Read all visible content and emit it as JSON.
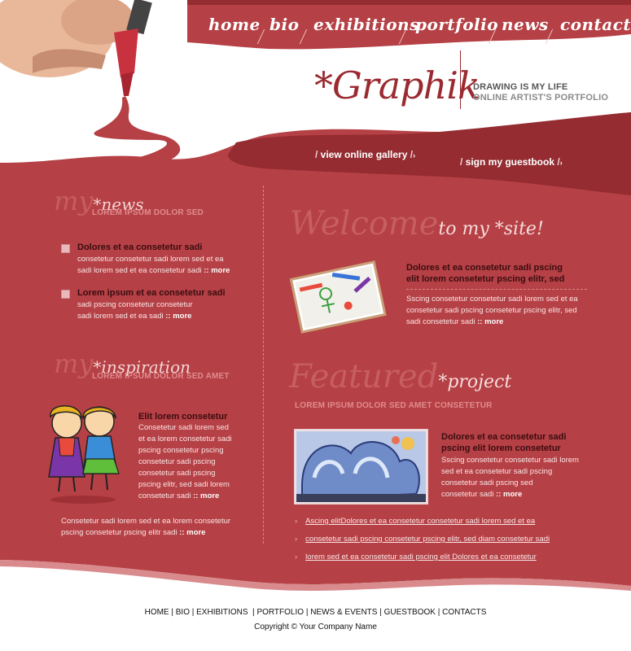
{
  "nav": {
    "home": "home",
    "bio": "bio",
    "exhibitions": "exhibitions",
    "portfolio": "portfolio",
    "news": "news",
    "contact": "contact"
  },
  "brand": {
    "logo": "*Graphik",
    "tagline1": "DRAWING IS MY LIFE",
    "tagline2": "ONLINE ARTIST'S PORTFOLIO"
  },
  "header_links": {
    "gallery": "view online gallery",
    "guestbook": "sign my guestbook"
  },
  "news": {
    "title_big": "my",
    "title_small": "*news",
    "subtitle": "LOREM IPSUM DOLOR SED",
    "items": [
      {
        "title": "Dolores et ea consetetur sadi",
        "line1": "consetetur consetetur sadi lorem sed  et ea",
        "line2": "sadi lorem sed  et ea consetetur sadi",
        "more": ":: more"
      },
      {
        "title": "Lorem ipsum et ea consetetur sadi",
        "line1": "sadi pscing consetetur consetetur",
        "line2": "sadi lorem sed  et ea sadi",
        "more": ":: more"
      }
    ]
  },
  "inspiration": {
    "title_big": "my",
    "title_small": "*inspiration",
    "subtitle": "LOREM IPSUM DOLOR SED AMET",
    "item_title": "Elit lorem consetetur",
    "item_lines": [
      "Consetetur sadi lorem sed",
      "et ea lorem consetetur sadi",
      "pscing consetetur pscing",
      "consetetur sadi pscing",
      "consetetur sadi pscing",
      "pscing elitr, sed sadi lorem",
      "consetetur sadi"
    ],
    "item_more": ":: more",
    "footer_line1": "Consetetur sadi lorem sed  et ea lorem consetetur",
    "footer_line2": "pscing consetetur pscing elitr sadi",
    "footer_more": ":: more"
  },
  "welcome": {
    "title_big": "Welcome",
    "title_small": "to my *site!",
    "item_title_line1": "Dolores et ea consetetur sadi pscing",
    "item_title_line2": "elit lorem consetetur pscing elitr, sed",
    "text_line1": "Sscing  consetetur consetetur sadi lorem sed  et ea",
    "text_line2": "consetetur sadi pscing consetetur pscing elitr, sed",
    "text_line3": "sadi consetetur sadi",
    "more": ":: more"
  },
  "featured": {
    "title_big": "Featured",
    "title_small": "*project",
    "subtitle": "LOREM IPSUM DOLOR SED  AMET CONSETETUR",
    "item_title_line1": "Dolores et ea consetetur sadi",
    "item_title_line2": "pscing elit lorem consetetur",
    "text_lines": [
      "Sscing  consetetur consetetur sadi lorem",
      "sed  et ea consetetur sadi pscing",
      "consetetur sadi pscing sed",
      "consetetur sadi"
    ],
    "more": ":: more",
    "links": [
      "Ascing elitDolores et ea consetetur consetetur sadi lorem sed  et ea",
      "consetetur sadi pscing consetetur pscing elitr, sed diam consetetur sadi",
      "lorem sed  et ea consetetur sadi pscing elit Dolores et ea consetetur"
    ]
  },
  "footer": {
    "links": [
      "HOME",
      "BIO",
      "EXHIBITIONS",
      "PORTFOLIO",
      "NEWS & EVENTS",
      "GUESTBOOK",
      "CONTACTS"
    ],
    "copyright": "Copyright © Your Company Name"
  },
  "colors": {
    "primary_red": "#b54045",
    "dark_red": "#942c31",
    "light_text": "#fbe6e6",
    "title_dark": "#3a0d10"
  }
}
